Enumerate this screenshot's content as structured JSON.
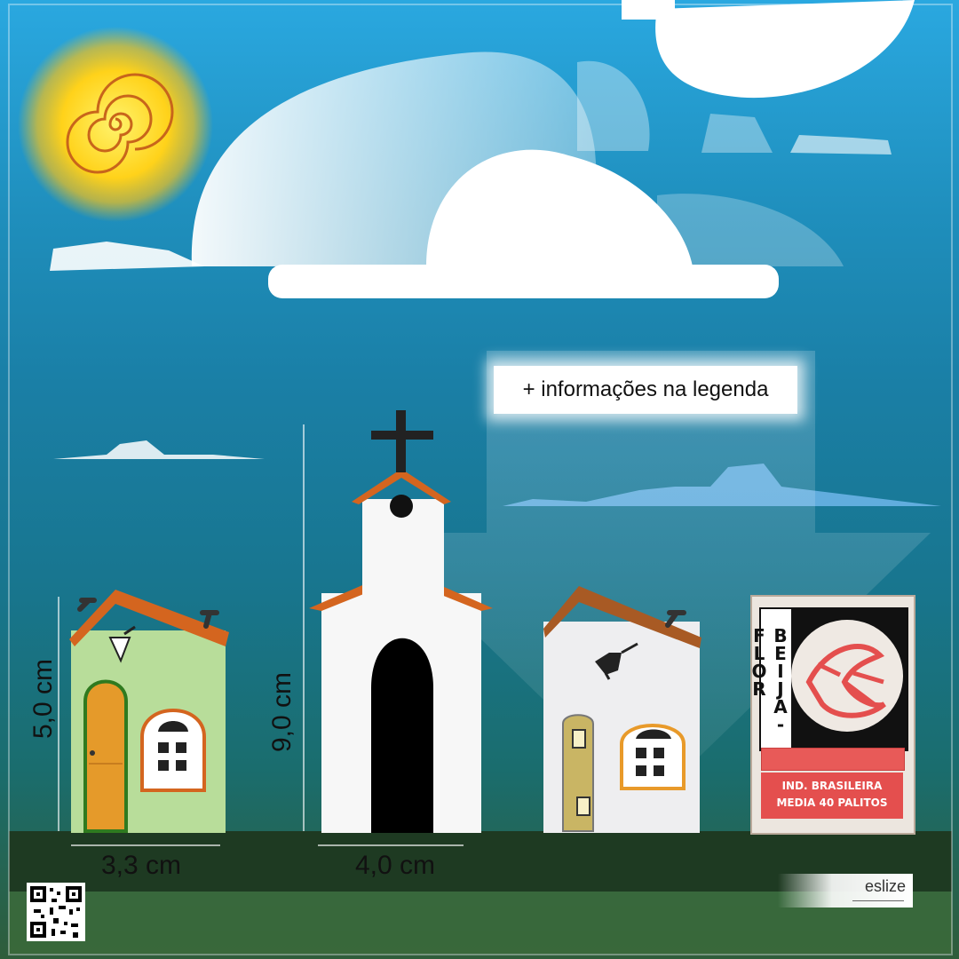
{
  "hint": "+ informações na legenda",
  "dimensions": {
    "house_height": "5,0 cm",
    "house_width": "3,3 cm",
    "church_height": "9,0 cm",
    "church_width": "4,0 cm"
  },
  "matchbox": {
    "brand": "BEIJA-FLOR",
    "line1": "IND. BRASILEIRA",
    "line2": "MEDIA 40 PALITOS"
  },
  "watermark": "eslize",
  "colors": {
    "sky_top": "#2aa8e0",
    "ground": "#1e3a22",
    "sun": "#ffd21a",
    "roof": "#d4651f",
    "house_green": "#b8dd9a",
    "matchbox_red": "#e44f4e"
  }
}
